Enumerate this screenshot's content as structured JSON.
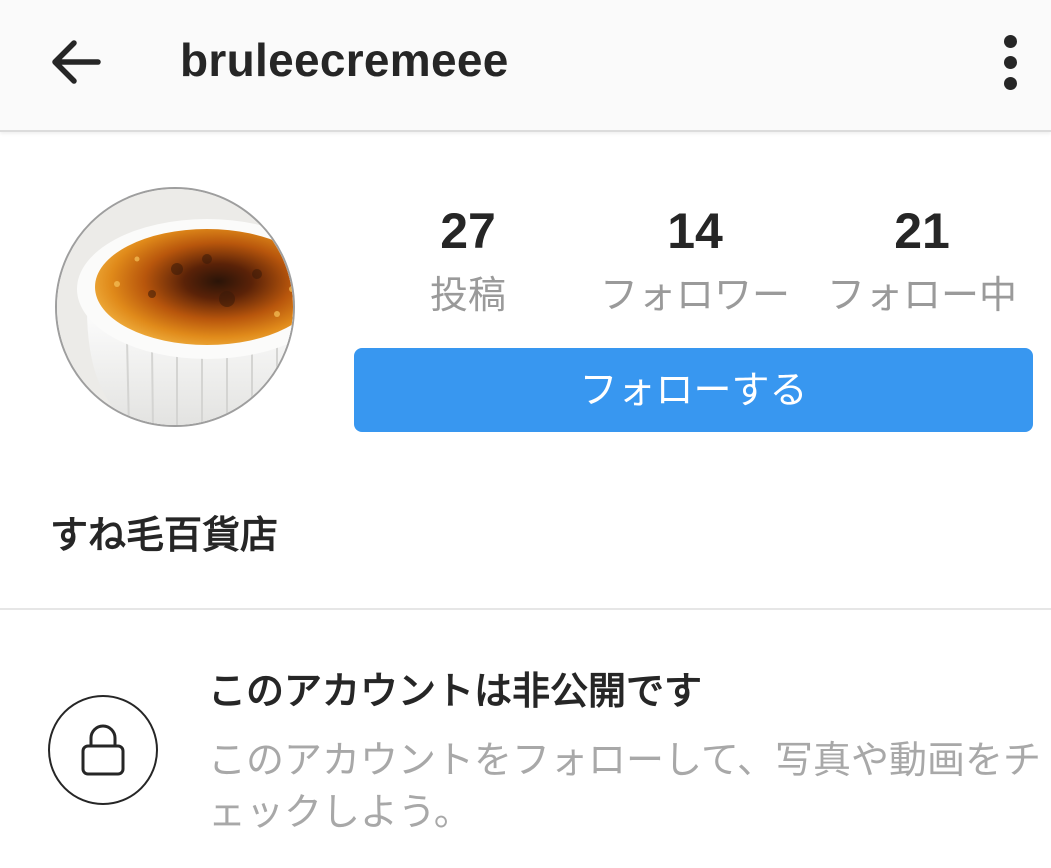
{
  "header": {
    "username": "bruleecremeee",
    "back_icon": "arrow-left-icon",
    "menu_icon": "more-vertical-icon"
  },
  "profile": {
    "avatar_alt": "crème brûlée photo",
    "stats": {
      "posts": {
        "count": "27",
        "label": "投稿"
      },
      "followers": {
        "count": "14",
        "label": "フォロワー"
      },
      "following": {
        "count": "21",
        "label": "フォロー中"
      }
    },
    "follow_button_label": "フォローする",
    "display_name": "すね毛百貨店"
  },
  "private_notice": {
    "icon": "lock-icon",
    "title": "このアカウントは非公開です",
    "description": "このアカウントをフォローして、写真や動画をチェックしよう。"
  },
  "colors": {
    "accent": "#3897f0",
    "text_primary": "#262626",
    "text_secondary": "#9a9a9a"
  }
}
